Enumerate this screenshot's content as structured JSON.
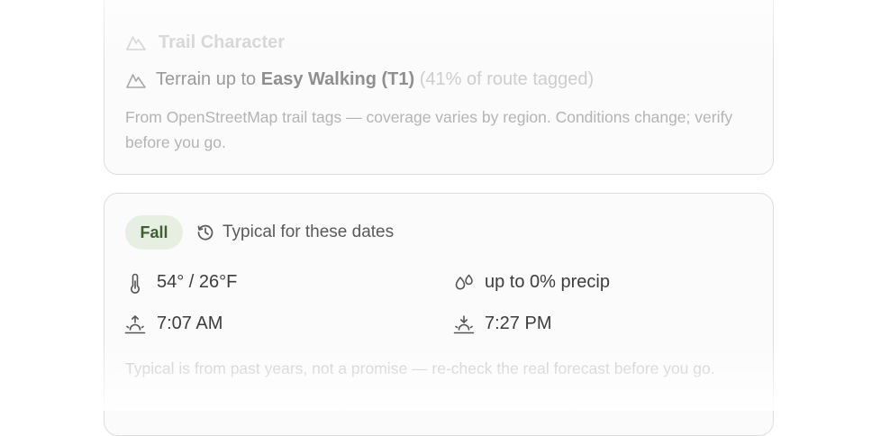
{
  "trail": {
    "title": "Trail Character",
    "title_icon": "mountain-icon",
    "terrain_prefix": "Terrain up to",
    "terrain_value": "Easy Walking (T1)",
    "terrain_coverage": "(41% of route tagged)",
    "terrain_icon": "mountain-icon",
    "note": "From OpenStreetMap trail tags — coverage varies by region. Conditions change; verify before you go."
  },
  "weather": {
    "season_badge": "Fall",
    "typical_label": "Typical for these dates",
    "typical_icon": "history-icon",
    "temperature": "54° / 26°F",
    "temperature_icon": "thermometer-icon",
    "precip": "up to 0% precip",
    "precip_icon": "droplets-icon",
    "sunrise": "7:07 AM",
    "sunrise_icon": "sunrise-icon",
    "sunset": "7:27 PM",
    "sunset_icon": "sunset-icon",
    "footnote": "Typical is from past years, not a promise — re-check the real forecast before you go."
  },
  "colors": {
    "badge_bg": "#e6efe1",
    "badge_text": "#3e5f33",
    "card_bg": "#fbfbfb",
    "card_border": "#dedede"
  }
}
